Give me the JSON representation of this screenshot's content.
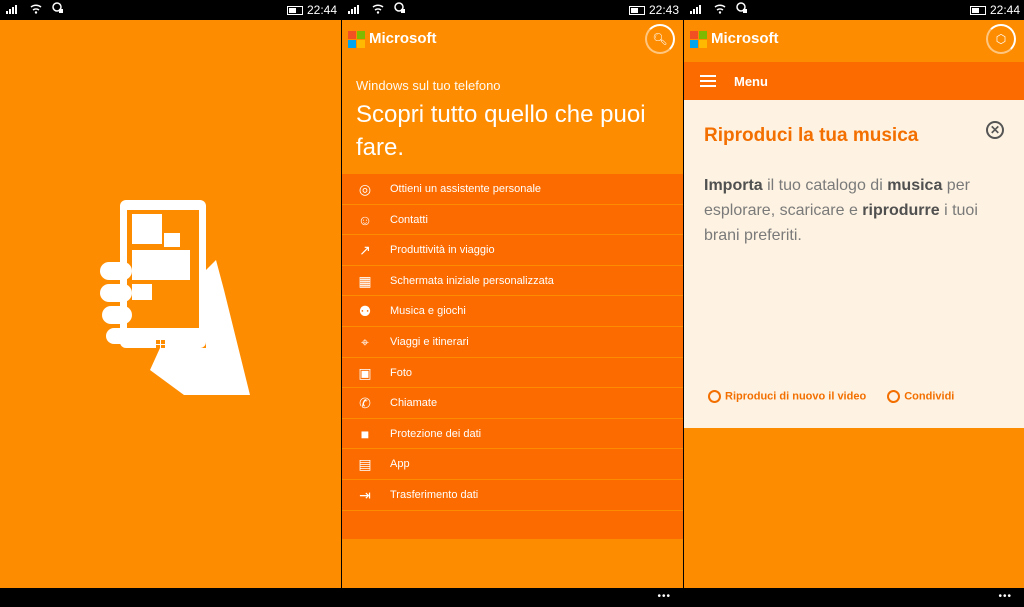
{
  "panel1": {
    "status": {
      "time": "22:44"
    }
  },
  "panel2": {
    "status": {
      "time": "22:43"
    },
    "header": {
      "brand": "Microsoft"
    },
    "subtitle": "Windows sul tuo telefono",
    "headline": "Scopri tutto quello che puoi fare.",
    "menu": [
      {
        "icon": "cortana-icon",
        "label": "Ottieni un assistente personale"
      },
      {
        "icon": "contacts-icon",
        "label": "Contatti"
      },
      {
        "icon": "productivity-icon",
        "label": "Produttività in viaggio"
      },
      {
        "icon": "start-screen-icon",
        "label": "Schermata iniziale personalizzata"
      },
      {
        "icon": "gamepad-icon",
        "label": "Musica e giochi"
      },
      {
        "icon": "map-pin-icon",
        "label": "Viaggi e itinerari"
      },
      {
        "icon": "camera-icon",
        "label": "Foto"
      },
      {
        "icon": "phone-icon",
        "label": "Chiamate"
      },
      {
        "icon": "lock-icon",
        "label": "Protezione dei dati"
      },
      {
        "icon": "store-icon",
        "label": "App"
      },
      {
        "icon": "transfer-icon",
        "label": "Trasferimento dati"
      }
    ]
  },
  "panel3": {
    "status": {
      "time": "22:44"
    },
    "header": {
      "brand": "Microsoft"
    },
    "menu_label": "Menu",
    "card": {
      "title": "Riproduci la tua musica",
      "body_parts": [
        "Importa",
        " il tuo catalogo di ",
        "musica",
        " per esplorare, scaricare e ",
        "riprodurre",
        " i tuoi brani preferiti."
      ],
      "replay_label": "Riproduci di nuovo il video",
      "share_label": "Condividi"
    }
  },
  "colors": {
    "accent": "#fe8c00",
    "menu_bg": "#fb6b00",
    "card_bg": "#fef3e2",
    "title": "#f26f00"
  }
}
